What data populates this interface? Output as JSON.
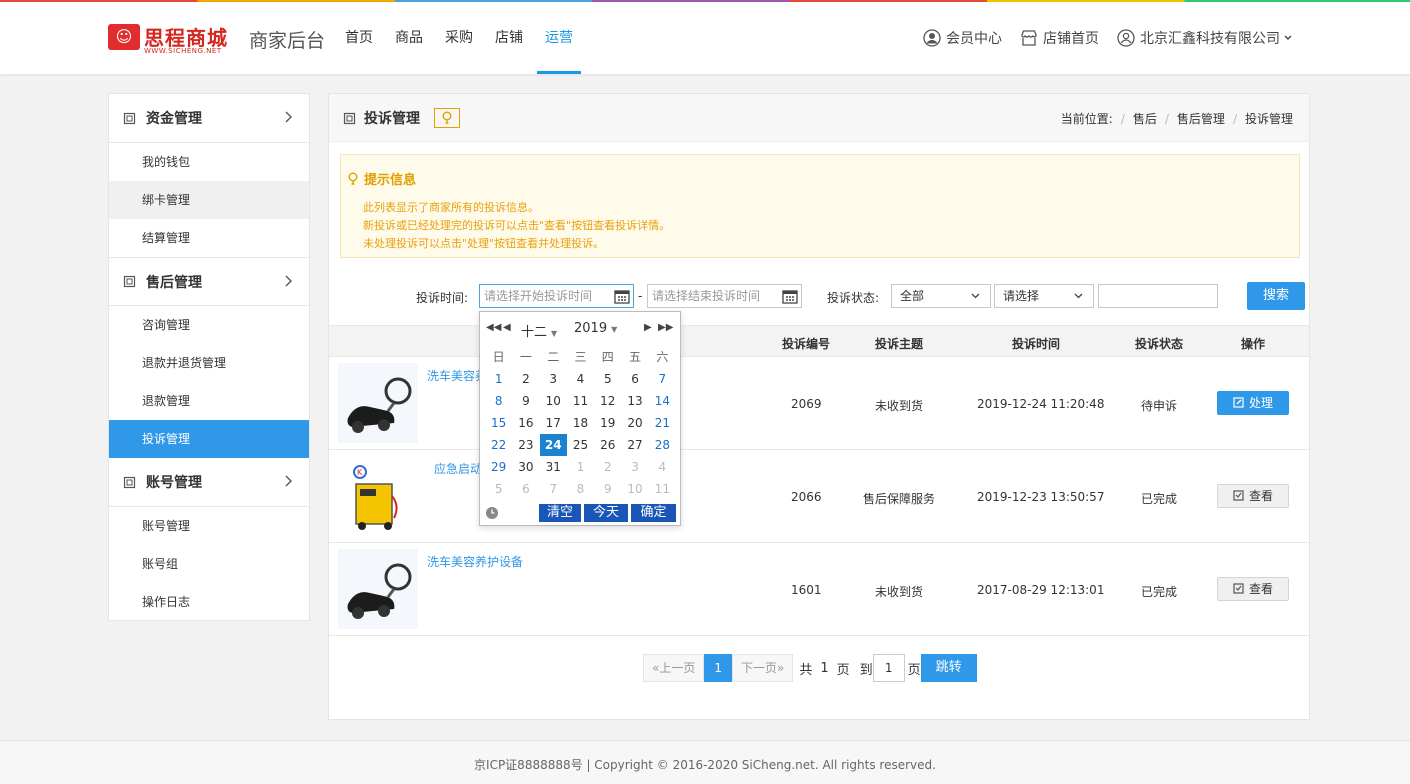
{
  "header": {
    "logo_text": "思程商城",
    "logo_sub": "WWW.SICHENG.NET",
    "app_title": "商家后台",
    "nav": [
      "首页",
      "商品",
      "采购",
      "店铺",
      "运营"
    ],
    "right": {
      "member_center": "会员中心",
      "store_home": "店铺首页",
      "company": "北京汇鑫科技有限公司"
    }
  },
  "sidebar": {
    "sections": [
      {
        "title": "资金管理",
        "items": [
          "我的钱包",
          "绑卡管理",
          "结算管理"
        ]
      },
      {
        "title": "售后管理",
        "items": [
          "咨询管理",
          "退款并退货管理",
          "退款管理",
          "投诉管理"
        ]
      },
      {
        "title": "账号管理",
        "items": [
          "账号管理",
          "账号组",
          "操作日志"
        ]
      }
    ]
  },
  "page": {
    "title": "投诉管理",
    "breadcrumb": {
      "label": "当前位置:",
      "items": [
        "售后",
        "售后管理",
        "投诉管理"
      ]
    }
  },
  "notice": {
    "title": "提示信息",
    "lines": [
      "此列表显示了商家所有的投诉信息。",
      "新投诉或已经处理完的投诉可以点击\"查看\"按钮查看投诉详情。",
      "未处理投诉可以点击\"处理\"按钮查看并处理投诉。"
    ]
  },
  "filters": {
    "time_label": "投诉时间:",
    "start_placeholder": "请选择开始投诉时间",
    "end_placeholder": "请选择结束投诉时间",
    "dash": "-",
    "status_label": "投诉状态:",
    "status_value": "全部",
    "select2_value": "请选择",
    "search_button": "搜索"
  },
  "table": {
    "headers": [
      "投诉编号",
      "投诉主题",
      "投诉时间",
      "投诉状态",
      "操作"
    ],
    "rows": [
      {
        "product": "洗车美容养",
        "id": "2069",
        "subject": "未收到货",
        "time": "2019-12-24 11:20:48",
        "status": "待申诉",
        "action": "处理"
      },
      {
        "product": "应急启动",
        "id": "2066",
        "subject": "售后保障服务",
        "time": "2019-12-23 13:50:57",
        "status": "已完成",
        "action": "查看"
      },
      {
        "product": "洗车美容养护设备",
        "id": "1601",
        "subject": "未收到货",
        "time": "2017-08-29 12:13:01",
        "status": "已完成",
        "action": "查看"
      }
    ]
  },
  "pagination": {
    "prev": "«上一页",
    "current": "1",
    "next": "下一页»",
    "total_prefix": "共",
    "total_pages": "1",
    "pages_word": "页",
    "goto_prefix": "到",
    "goto_value": "1",
    "goto_suffix": "页",
    "go_button": "跳转"
  },
  "calendar": {
    "month": "十二",
    "year": "2019",
    "weekdays": [
      "日",
      "一",
      "二",
      "三",
      "四",
      "五",
      "六"
    ],
    "weeks": [
      [
        "1",
        "2",
        "3",
        "4",
        "5",
        "6",
        "7"
      ],
      [
        "8",
        "9",
        "10",
        "11",
        "12",
        "13",
        "14"
      ],
      [
        "15",
        "16",
        "17",
        "18",
        "19",
        "20",
        "21"
      ],
      [
        "22",
        "23",
        "24",
        "25",
        "26",
        "27",
        "28"
      ],
      [
        "29",
        "30",
        "31",
        "1",
        "2",
        "3",
        "4"
      ],
      [
        "5",
        "6",
        "7",
        "8",
        "9",
        "10",
        "11"
      ]
    ],
    "selected": "24",
    "buttons": {
      "clear": "清空",
      "today": "今天",
      "ok": "确定"
    }
  },
  "footer": {
    "text": "京ICP证8888888号 | Copyright © 2016-2020 SiCheng.net. All rights reserved."
  },
  "colors": {
    "accent": "#2f98e8",
    "notice": "#e8a010",
    "brand": "#d7261e"
  }
}
